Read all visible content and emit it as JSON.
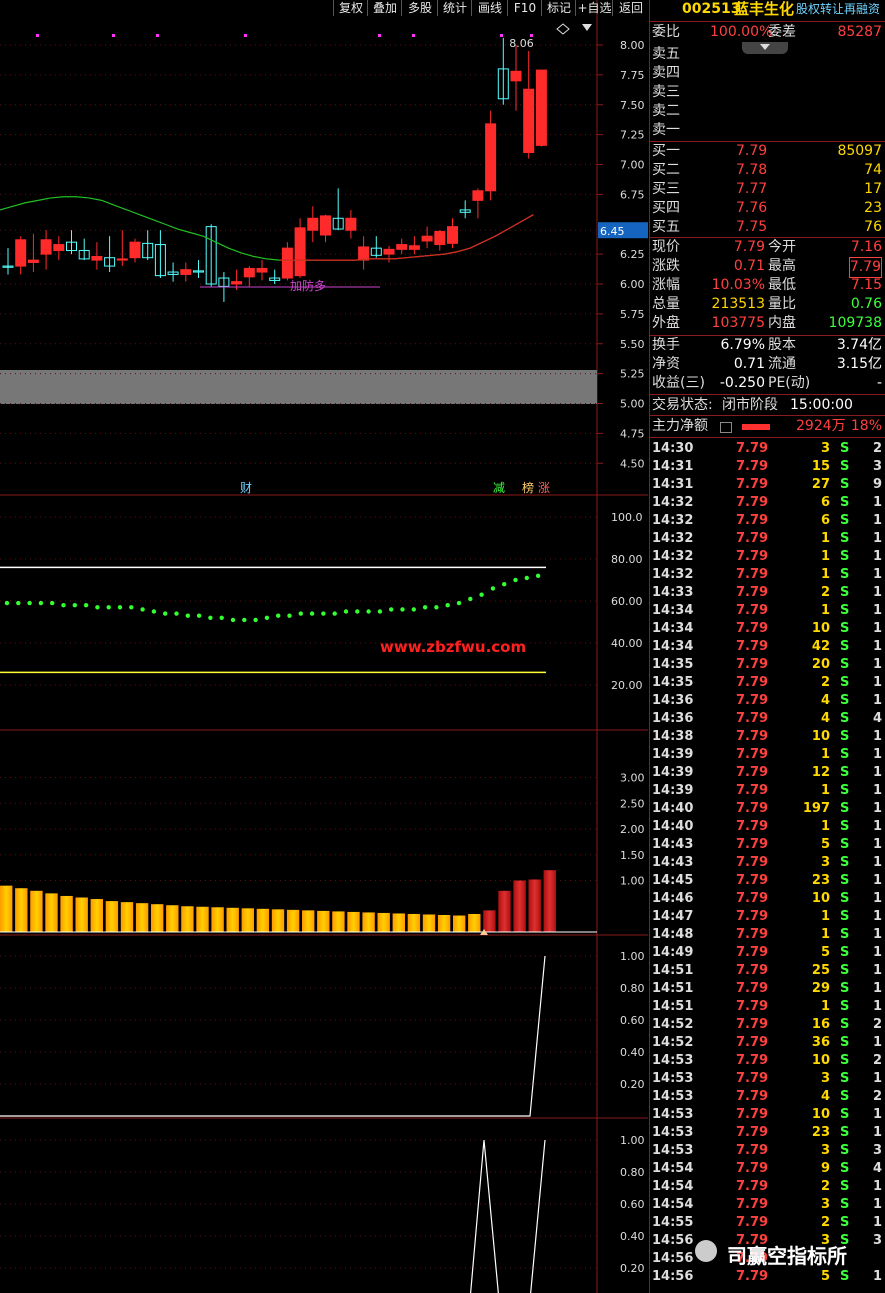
{
  "toolbar": [
    "复权",
    "叠加",
    "多股",
    "统计",
    "画线",
    "F10",
    "标记",
    "+自选",
    "返回"
  ],
  "stock": {
    "code": "002513",
    "name": "蓝丰生化",
    "tag": "股权转让再融资"
  },
  "order_book": {
    "wei_bi_label": "委比",
    "wei_bi": "100.00%",
    "wei_cha_label": "委差",
    "wei_cha": "85287",
    "sell": [
      {
        "label": "卖五"
      },
      {
        "label": "卖四"
      },
      {
        "label": "卖三"
      },
      {
        "label": "卖二"
      },
      {
        "label": "卖一"
      }
    ],
    "buy": [
      {
        "label": "买一",
        "price": "7.79",
        "vol": "85097"
      },
      {
        "label": "买二",
        "price": "7.78",
        "vol": "74"
      },
      {
        "label": "买三",
        "price": "7.77",
        "vol": "17"
      },
      {
        "label": "买四",
        "price": "7.76",
        "vol": "23"
      },
      {
        "label": "买五",
        "price": "7.75",
        "vol": "76"
      }
    ]
  },
  "quote": [
    {
      "l1": "现价",
      "v1": "7.79",
      "l2": "今开",
      "v2": "7.16"
    },
    {
      "l1": "涨跌",
      "v1": "0.71",
      "l2": "最高",
      "v2": "7.79"
    },
    {
      "l1": "涨幅",
      "v1": "10.03%",
      "l2": "最低",
      "v2": "7.15"
    },
    {
      "l1": "总量",
      "v1": "213513",
      "l2": "量比",
      "v2": "0.76"
    },
    {
      "l1": "外盘",
      "v1": "103775",
      "l2": "内盘",
      "v2": "109738"
    }
  ],
  "fund": [
    {
      "l1": "换手",
      "v1": "6.79%",
      "l2": "股本",
      "v2": "3.74亿"
    },
    {
      "l1": "净资",
      "v1": "0.71",
      "l2": "流通",
      "v2": "3.15亿"
    },
    {
      "l1": "收益(三)",
      "v1": "-0.250",
      "l2": "PE(动)",
      "v2": "-"
    }
  ],
  "status": {
    "label": "交易状态:",
    "value": "闭市阶段",
    "time": "15:00:00"
  },
  "main_force": {
    "label": "主力净额",
    "amount": "2924万",
    "pct": "18%"
  },
  "ticks": [
    [
      "14:30",
      "7.79",
      "3",
      "S",
      "2"
    ],
    [
      "14:31",
      "7.79",
      "15",
      "S",
      "3"
    ],
    [
      "14:31",
      "7.79",
      "27",
      "S",
      "9"
    ],
    [
      "14:32",
      "7.79",
      "6",
      "S",
      "1"
    ],
    [
      "14:32",
      "7.79",
      "6",
      "S",
      "1"
    ],
    [
      "14:32",
      "7.79",
      "1",
      "S",
      "1"
    ],
    [
      "14:32",
      "7.79",
      "1",
      "S",
      "1"
    ],
    [
      "14:32",
      "7.79",
      "1",
      "S",
      "1"
    ],
    [
      "14:33",
      "7.79",
      "2",
      "S",
      "1"
    ],
    [
      "14:34",
      "7.79",
      "1",
      "S",
      "1"
    ],
    [
      "14:34",
      "7.79",
      "10",
      "S",
      "1"
    ],
    [
      "14:34",
      "7.79",
      "42",
      "S",
      "1"
    ],
    [
      "14:35",
      "7.79",
      "20",
      "S",
      "1"
    ],
    [
      "14:35",
      "7.79",
      "2",
      "S",
      "1"
    ],
    [
      "14:36",
      "7.79",
      "4",
      "S",
      "1"
    ],
    [
      "14:36",
      "7.79",
      "4",
      "S",
      "4"
    ],
    [
      "14:38",
      "7.79",
      "10",
      "S",
      "1"
    ],
    [
      "14:39",
      "7.79",
      "1",
      "S",
      "1"
    ],
    [
      "14:39",
      "7.79",
      "12",
      "S",
      "1"
    ],
    [
      "14:39",
      "7.79",
      "1",
      "S",
      "1"
    ],
    [
      "14:40",
      "7.79",
      "197",
      "S",
      "1"
    ],
    [
      "14:40",
      "7.79",
      "1",
      "S",
      "1"
    ],
    [
      "14:43",
      "7.79",
      "5",
      "S",
      "1"
    ],
    [
      "14:43",
      "7.79",
      "3",
      "S",
      "1"
    ],
    [
      "14:45",
      "7.79",
      "23",
      "S",
      "1"
    ],
    [
      "14:46",
      "7.79",
      "10",
      "S",
      "1"
    ],
    [
      "14:47",
      "7.79",
      "1",
      "S",
      "1"
    ],
    [
      "14:48",
      "7.79",
      "1",
      "S",
      "1"
    ],
    [
      "14:49",
      "7.79",
      "5",
      "S",
      "1"
    ],
    [
      "14:51",
      "7.79",
      "25",
      "S",
      "1"
    ],
    [
      "14:51",
      "7.79",
      "29",
      "S",
      "1"
    ],
    [
      "14:51",
      "7.79",
      "1",
      "S",
      "1"
    ],
    [
      "14:52",
      "7.79",
      "16",
      "S",
      "2"
    ],
    [
      "14:52",
      "7.79",
      "36",
      "S",
      "1"
    ],
    [
      "14:53",
      "7.79",
      "10",
      "S",
      "2"
    ],
    [
      "14:53",
      "7.79",
      "3",
      "S",
      "1"
    ],
    [
      "14:53",
      "7.79",
      "4",
      "S",
      "2"
    ],
    [
      "14:53",
      "7.79",
      "10",
      "S",
      "1"
    ],
    [
      "14:53",
      "7.79",
      "23",
      "S",
      "1"
    ],
    [
      "14:53",
      "7.79",
      "3",
      "S",
      "3"
    ],
    [
      "14:54",
      "7.79",
      "9",
      "S",
      "4"
    ],
    [
      "14:54",
      "7.79",
      "2",
      "S",
      "1"
    ],
    [
      "14:54",
      "7.79",
      "3",
      "S",
      "1"
    ],
    [
      "14:55",
      "7.79",
      "2",
      "S",
      "1"
    ],
    [
      "14:56",
      "7.79",
      "3",
      "S",
      "3"
    ],
    [
      "14:56",
      "7.79",
      "",
      "",
      ""
    ],
    [
      "14:56",
      "7.79",
      "5",
      "S",
      "1"
    ]
  ],
  "watermark": {
    "text": "司赢空指标所"
  },
  "chart_data": [
    {
      "type": "candlestick",
      "price_axis": [
        "8.00",
        "7.75",
        "7.50",
        "7.25",
        "7.00",
        "6.75",
        "6.45",
        "6.25",
        "6.00",
        "5.75",
        "5.50",
        "5.25",
        "5.00",
        "4.75",
        "4.50"
      ],
      "current_price_tag": "6.45",
      "high_label": "8.06",
      "annotation": "加防多",
      "event_labels": [
        "财",
        "减",
        "榜",
        "涨"
      ],
      "ohlc": [
        [
          6.15,
          6.3,
          6.08,
          6.14
        ],
        [
          6.15,
          6.4,
          6.08,
          6.37
        ],
        [
          6.18,
          6.42,
          6.1,
          6.2
        ],
        [
          6.25,
          6.45,
          6.12,
          6.37
        ],
        [
          6.28,
          6.4,
          6.2,
          6.33
        ],
        [
          6.35,
          6.45,
          6.25,
          6.28
        ],
        [
          6.28,
          6.38,
          6.2,
          6.21
        ],
        [
          6.2,
          6.35,
          6.12,
          6.23
        ],
        [
          6.22,
          6.4,
          6.1,
          6.15
        ],
        [
          6.2,
          6.45,
          6.15,
          6.21
        ],
        [
          6.22,
          6.38,
          6.18,
          6.35
        ],
        [
          6.34,
          6.45,
          6.2,
          6.22
        ],
        [
          6.33,
          6.45,
          6.05,
          6.07
        ],
        [
          6.1,
          6.18,
          6.02,
          6.08
        ],
        [
          6.08,
          6.18,
          6.02,
          6.12
        ],
        [
          6.11,
          6.2,
          6.05,
          6.1
        ],
        [
          6.48,
          6.5,
          5.98,
          6.0
        ],
        [
          6.05,
          6.1,
          5.85,
          5.98
        ],
        [
          6.0,
          6.12,
          5.95,
          6.02
        ],
        [
          6.06,
          6.15,
          5.98,
          6.13
        ],
        [
          6.1,
          6.2,
          6.03,
          6.13
        ],
        [
          6.05,
          6.12,
          6.0,
          6.03
        ],
        [
          6.05,
          6.35,
          6.03,
          6.3
        ],
        [
          6.07,
          6.55,
          6.05,
          6.47
        ],
        [
          6.45,
          6.65,
          6.35,
          6.55
        ],
        [
          6.41,
          6.58,
          6.35,
          6.57
        ],
        [
          6.55,
          6.8,
          6.45,
          6.46
        ],
        [
          6.45,
          6.62,
          6.38,
          6.55
        ],
        [
          6.2,
          6.4,
          6.12,
          6.31
        ],
        [
          6.3,
          6.4,
          6.22,
          6.24
        ],
        [
          6.25,
          6.32,
          6.18,
          6.29
        ],
        [
          6.29,
          6.38,
          6.25,
          6.33
        ],
        [
          6.29,
          6.4,
          6.25,
          6.32
        ],
        [
          6.36,
          6.48,
          6.3,
          6.4
        ],
        [
          6.33,
          6.45,
          6.28,
          6.44
        ],
        [
          6.34,
          6.55,
          6.3,
          6.48
        ],
        [
          6.62,
          6.7,
          6.55,
          6.6
        ],
        [
          6.7,
          6.8,
          6.55,
          6.78
        ],
        [
          6.78,
          7.45,
          6.7,
          7.34
        ],
        [
          7.8,
          8.06,
          7.5,
          7.55
        ],
        [
          7.7,
          8.0,
          7.45,
          7.78
        ],
        [
          7.1,
          7.95,
          7.05,
          7.63
        ],
        [
          7.16,
          7.79,
          7.15,
          7.79
        ]
      ],
      "ma": [
        6.62,
        6.65,
        6.68,
        6.7,
        6.72,
        6.73,
        6.73,
        6.72,
        6.7,
        6.66,
        6.62,
        6.58,
        6.54,
        6.5,
        6.46,
        6.43,
        6.4,
        6.35,
        6.3,
        6.26,
        6.23,
        6.21,
        6.2,
        6.2,
        6.2,
        6.2,
        6.2,
        6.2,
        6.2,
        6.21,
        6.21,
        6.21,
        6.22,
        6.23,
        6.24,
        6.25,
        6.27,
        6.3,
        6.35,
        6.4,
        6.46,
        6.52,
        6.58
      ]
    },
    {
      "type": "scatter",
      "y_axis": [
        "100.0",
        "80.00",
        "60.00",
        "40.00",
        "20.00"
      ],
      "upper_line": 76,
      "lower_line": 26,
      "values": [
        59,
        59,
        59,
        59,
        59,
        58,
        58,
        58,
        57,
        57,
        57,
        57,
        56,
        55,
        54,
        54,
        53,
        53,
        52,
        52,
        51,
        51,
        51,
        52,
        53,
        53,
        54,
        54,
        54,
        54,
        55,
        55,
        55,
        55,
        56,
        56,
        56,
        57,
        57,
        58,
        59,
        61,
        63,
        66,
        68,
        70,
        71,
        72
      ],
      "watermark": "www.zbzfwu.com"
    },
    {
      "type": "bar",
      "y_axis": [
        "3.00",
        "2.50",
        "2.00",
        "1.50",
        "1.00"
      ],
      "values": [
        1.72,
        1.62,
        1.52,
        1.45,
        1.38,
        1.3,
        1.22,
        1.16,
        1.1,
        1.05,
        1.0,
        0.95,
        0.9,
        0.85,
        0.8,
        0.75,
        0.7,
        0.67,
        0.64,
        0.6,
        0.58,
        0.56,
        0.54,
        0.52,
        0.5,
        0.49,
        0.48,
        0.47,
        0.46,
        0.45,
        0.44,
        0.43,
        0.42,
        0.41,
        0.4,
        0.39,
        0.38,
        0.37,
        0.36,
        0.35,
        0.34,
        0.33,
        0.32,
        0.35,
        0.42,
        0.8,
        1.0,
        1.02,
        1.2
      ],
      "red_from_index": 44
    },
    {
      "type": "line",
      "y_axis": [
        "1.00",
        "0.80",
        "0.60",
        "0.40",
        "0.20"
      ],
      "x": [
        0,
        29,
        30,
        30.5
      ],
      "y": [
        0,
        0,
        0,
        1
      ]
    },
    {
      "type": "line",
      "y_axis": [
        "1.00",
        "0.80",
        "0.60",
        "0.40",
        "0.20"
      ],
      "x": [
        26,
        28,
        30,
        31
      ],
      "y": [
        0,
        1,
        0,
        1
      ]
    }
  ]
}
